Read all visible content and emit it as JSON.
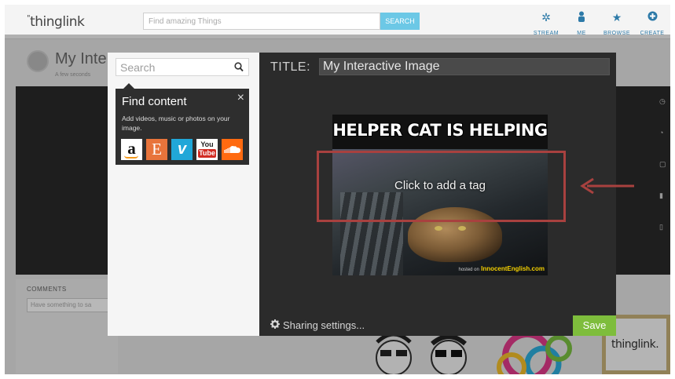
{
  "app": {
    "logo": "thinglink",
    "header_search_placeholder": "Find amazing Things",
    "header_search_button": "SEARCH",
    "nav": [
      {
        "label": "STREAM",
        "icon": "stream-icon"
      },
      {
        "label": "ME",
        "icon": "person-icon"
      },
      {
        "label": "BROWSE",
        "icon": "star-icon"
      },
      {
        "label": "CREATE",
        "icon": "plus-circle-icon"
      }
    ]
  },
  "background": {
    "page_title": "My Inte",
    "page_subtitle": "A few seconds",
    "comments_label": "COMMENTS",
    "comment_placeholder": "Have something to sa",
    "footer_logo": "thinglink."
  },
  "editor": {
    "content_search_placeholder": "Search",
    "find_content": {
      "title": "Find content",
      "close": "×",
      "description": "Add videos, music or photos on your image.",
      "providers": [
        {
          "name": "amazon",
          "glyph": "a"
        },
        {
          "name": "etsy",
          "glyph": "E"
        },
        {
          "name": "vimeo",
          "glyph": "v"
        },
        {
          "name": "youtube",
          "glyph_top": "You",
          "glyph_bottom": "Tube"
        },
        {
          "name": "soundcloud",
          "glyph": ""
        }
      ]
    },
    "title_label": "TITLE:",
    "title_value": "My Interactive Image",
    "image": {
      "caption": "HELPER CAT IS HELPING",
      "tag_hint": "Click to add a tag",
      "watermark_prefix": "hosted on",
      "watermark": "InnocentEnglish.com"
    },
    "sharing_settings": "Sharing settings...",
    "save_label": "Save"
  },
  "colors": {
    "annotation": "#a8413f",
    "save": "#7ebd3c",
    "nav": "#2d7aa8",
    "search_button": "#6cc8e6"
  }
}
